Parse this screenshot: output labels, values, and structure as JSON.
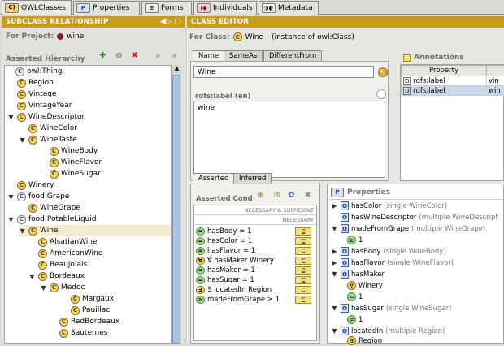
{
  "tabs": [
    {
      "label": "OWLClasses",
      "icon": "C)"
    },
    {
      "label": "Properties",
      "icon": "P"
    },
    {
      "label": "Forms",
      "icon": "≡"
    },
    {
      "label": "Individuals",
      "icon": "I◆"
    },
    {
      "label": "Metadata",
      "icon": "◑◐"
    }
  ],
  "left": {
    "title": "SUBCLASS RELATIONSHIP",
    "project_label": "For Project:",
    "project_name": "wine",
    "hierarchy_label": "Asserted Hierarchy",
    "tree": [
      {
        "label": "owl:Thing",
        "toggle": "",
        "plain": true
      },
      {
        "label": "Region",
        "toggle": ""
      },
      {
        "label": "Vintage",
        "toggle": ""
      },
      {
        "label": "VintageYear",
        "toggle": ""
      },
      {
        "label": "WineDescriptor",
        "toggle": "▼"
      },
      {
        "label": "WineColor",
        "toggle": ""
      },
      {
        "label": "WineTaste",
        "toggle": "▼"
      },
      {
        "label": "WineBody",
        "toggle": ""
      },
      {
        "label": "WineFlavor",
        "toggle": ""
      },
      {
        "label": "WineSugar",
        "toggle": ""
      },
      {
        "label": "Winery",
        "toggle": ""
      },
      {
        "label": "food:Grape",
        "toggle": "▼",
        "plain": true
      },
      {
        "label": "WineGrape",
        "toggle": ""
      },
      {
        "label": "food:PotableLiquid",
        "toggle": "▼",
        "plain": true
      },
      {
        "label": "Wine",
        "toggle": "▼",
        "selected": true
      },
      {
        "label": "AlsatianWine",
        "toggle": ""
      },
      {
        "label": "AmericanWine",
        "toggle": ""
      },
      {
        "label": "Beaujolais",
        "toggle": ""
      },
      {
        "label": "Bordeaux",
        "toggle": "▼"
      },
      {
        "label": "Medoc",
        "toggle": "▼"
      },
      {
        "label": "Margaux",
        "toggle": ""
      },
      {
        "label": "Pauillac",
        "toggle": ""
      },
      {
        "label": "RedBordeaux",
        "toggle": ""
      },
      {
        "label": "Sauternes",
        "toggle": ""
      }
    ]
  },
  "editor": {
    "title": "CLASS EDITOR",
    "for_class_label": "For Class:",
    "class_name": "Wine",
    "instance_of": "(instance of owl:Class)",
    "name_tabs": [
      "Name",
      "SameAs",
      "DifferentFrom"
    ],
    "name_value": "Wine",
    "rdfs_label_caption": "rdfs:label (en)",
    "rdfs_label_value": "wine",
    "annotations_title": "Annotations",
    "annotations_header": "Property",
    "annotations": [
      {
        "property": "rdfs:label",
        "value": "vin"
      },
      {
        "property": "rdfs:label",
        "value": "win"
      }
    ],
    "cond_tabs": [
      "Asserted",
      "Inferred"
    ],
    "cond_caption": "Asserted Cond",
    "nec_suff": "NECESSARY & SUFFICIENT",
    "necessary": "NECESSARY",
    "conditions": [
      {
        "text": "hasBody = 1",
        "icon": "="
      },
      {
        "text": "hasColor = 1",
        "icon": "="
      },
      {
        "text": "hasFlavor = 1",
        "icon": "="
      },
      {
        "text": "∀ hasMaker Winery",
        "icon": "∀",
        "yellow": true
      },
      {
        "text": "hasMaker = 1",
        "icon": "="
      },
      {
        "text": "hasSugar = 1",
        "icon": "="
      },
      {
        "text": "∃ locatedIn Region",
        "icon": "∃",
        "yellow": true
      },
      {
        "text": "madeFromGrape ≥ 1",
        "icon": "≥"
      }
    ],
    "inherited_marker": "⊑",
    "properties_title": "Properties",
    "properties": [
      {
        "toggle": "▶",
        "name": "hasColor",
        "desc": "(single WineColor)",
        "sub": []
      },
      {
        "toggle": "",
        "name": "hasWineDescriptor",
        "desc": "(multiple WineDescript",
        "sub": []
      },
      {
        "toggle": "▼",
        "name": "madeFromGrape",
        "desc": "(multiple WineGrape)",
        "sub": [
          {
            "icon": "≥",
            "text": "1"
          }
        ]
      },
      {
        "toggle": "▶",
        "name": "hasBody",
        "desc": "(single WineBody)",
        "sub": []
      },
      {
        "toggle": "▶",
        "name": "hasFlavor",
        "desc": "(single WineFlavor)",
        "sub": []
      },
      {
        "toggle": "▼",
        "name": "hasMaker",
        "desc": "",
        "sub": [
          {
            "icon": "∀",
            "text": "Winery",
            "y": true
          },
          {
            "icon": "=",
            "text": "1"
          }
        ]
      },
      {
        "toggle": "▼",
        "name": "hasSugar",
        "desc": "(single WineSugar)",
        "sub": [
          {
            "icon": "=",
            "text": "1"
          }
        ]
      },
      {
        "toggle": "▼",
        "name": "locatedIn",
        "desc": "(multiple Region)",
        "sub": [
          {
            "icon": "∃",
            "text": "Region",
            "y": true
          }
        ]
      }
    ]
  },
  "colors": {
    "titlebar": "#c89c18",
    "selection": "#f3edd0",
    "annotation_highlight": "#c7d9ea"
  }
}
